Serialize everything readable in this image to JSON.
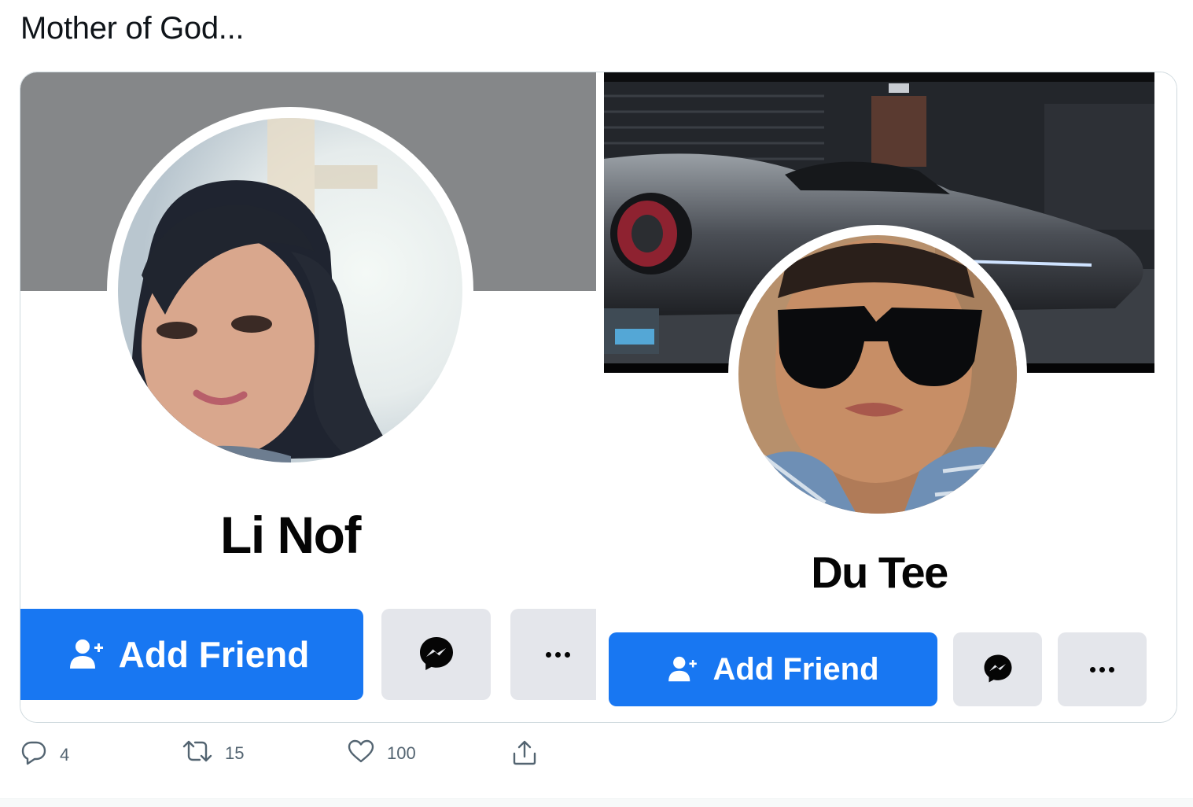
{
  "tweet": {
    "text": "Mother of God..."
  },
  "profiles": [
    {
      "name": "Li Nof",
      "cover": "plain-gray",
      "add_friend_label": "Add Friend",
      "messenger_icon": "messenger-icon",
      "more_icon": "more-dots-icon"
    },
    {
      "name": "Du Tee",
      "cover": "sports-car-garage",
      "add_friend_label": "Add Friend",
      "messenger_icon": "messenger-icon",
      "more_icon": "more-dots-icon"
    }
  ],
  "actions": {
    "reply_count": "4",
    "retweet_count": "15",
    "like_count": "100"
  },
  "colors": {
    "facebook_blue": "#1877f2",
    "button_gray": "#e4e6eb",
    "cover_gray": "#858789",
    "action_gray": "#536471",
    "card_border": "#cfd9de"
  }
}
